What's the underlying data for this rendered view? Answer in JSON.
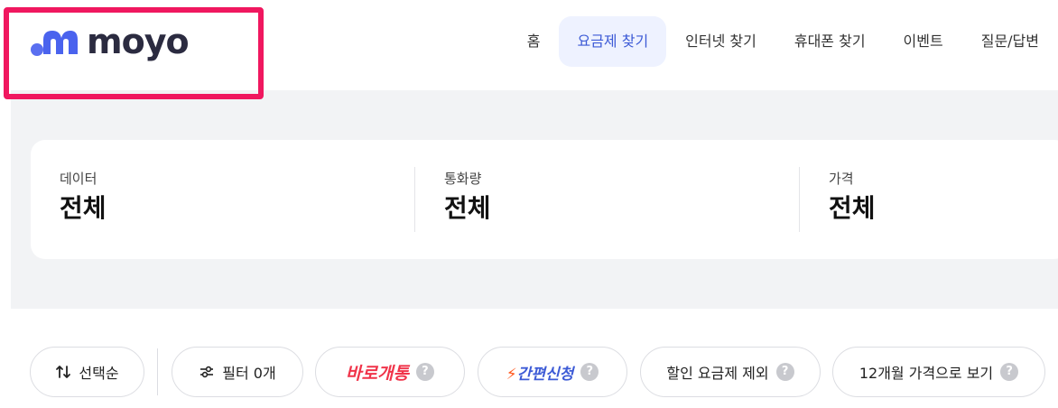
{
  "header": {
    "logo_text": "moyo",
    "nav": [
      {
        "label": "홈"
      },
      {
        "label": "요금제 찾기",
        "active": true
      },
      {
        "label": "인터넷 찾기"
      },
      {
        "label": "휴대폰 찾기"
      },
      {
        "label": "이벤트"
      },
      {
        "label": "질문/답변"
      }
    ]
  },
  "summary": {
    "data": {
      "label": "데이터",
      "value": "전체"
    },
    "calls": {
      "label": "통화량",
      "value": "전체"
    },
    "price": {
      "label": "가격",
      "value": "전체"
    }
  },
  "chips": {
    "sort": "선택순",
    "filter": "필터 0개",
    "instant": "바로개통",
    "easy": "간편신청",
    "exclude_discount": "할인 요금제 제외",
    "yearly_price": "12개월 가격으로 보기",
    "help_glyph": "?"
  },
  "colors": {
    "accent": "#3d5bd6",
    "highlight_box": "#f0175f",
    "instant_red": "#f0344a",
    "bolt_orange": "#ff5a1f"
  },
  "icons": [
    "moyo-logo-mark",
    "sort-arrows-icon",
    "filter-sliders-icon",
    "lightning-icon",
    "help-icon"
  ]
}
